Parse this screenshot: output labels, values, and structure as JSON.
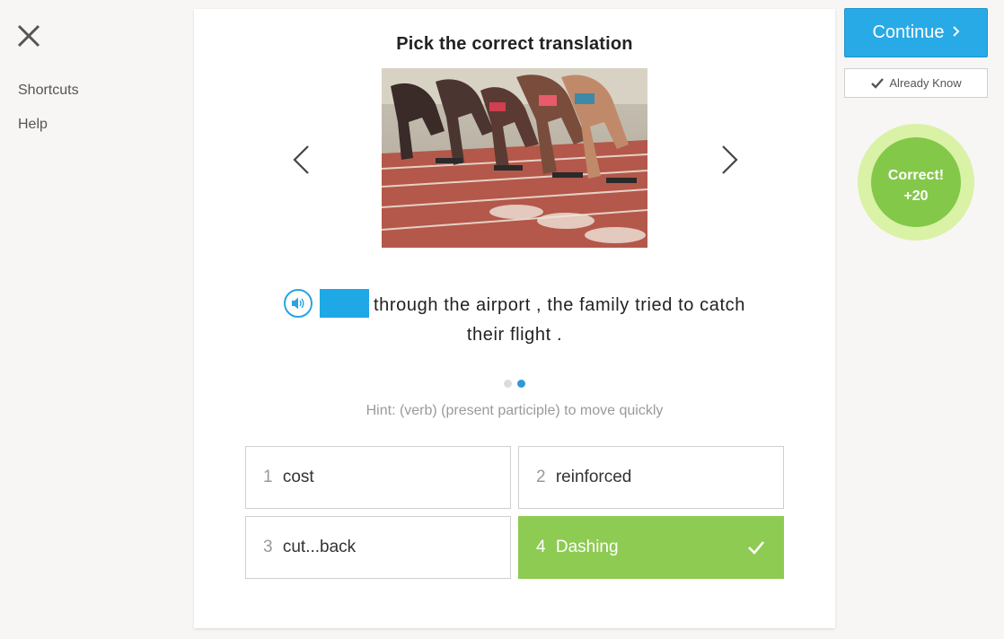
{
  "sidebar": {
    "close_icon": "close-x-icon",
    "links": {
      "shortcuts": "Shortcuts",
      "help": "Help"
    }
  },
  "card": {
    "title": "Pick the correct translation",
    "image_alt": "sprinters-starting-race-photo",
    "sentence": {
      "sound_icon": "speaker-icon",
      "text_line1": "through the airport , the family tried to catch",
      "text_line2": "their flight ."
    },
    "pagination": {
      "total": 2,
      "active": 2
    },
    "hint": "Hint: (verb) (present participle) to move quickly",
    "answers": [
      {
        "num": "1",
        "label": "cost",
        "selected": false
      },
      {
        "num": "2",
        "label": "reinforced",
        "selected": false
      },
      {
        "num": "3",
        "label": "cut...back",
        "selected": false
      },
      {
        "num": "4",
        "label": "Dashing",
        "selected": true,
        "correct": true
      }
    ]
  },
  "actions": {
    "continue_label": "Continue",
    "already_know_label": "Already Know"
  },
  "result_badge": {
    "line1": "Correct!",
    "line2": "+20"
  },
  "colors": {
    "accent_blue": "#28aae6",
    "correct_green": "#8dcb52",
    "badge_ring": "#d9f2a6",
    "badge_fill": "#84c84a",
    "page_bg": "#f7f6f5"
  }
}
